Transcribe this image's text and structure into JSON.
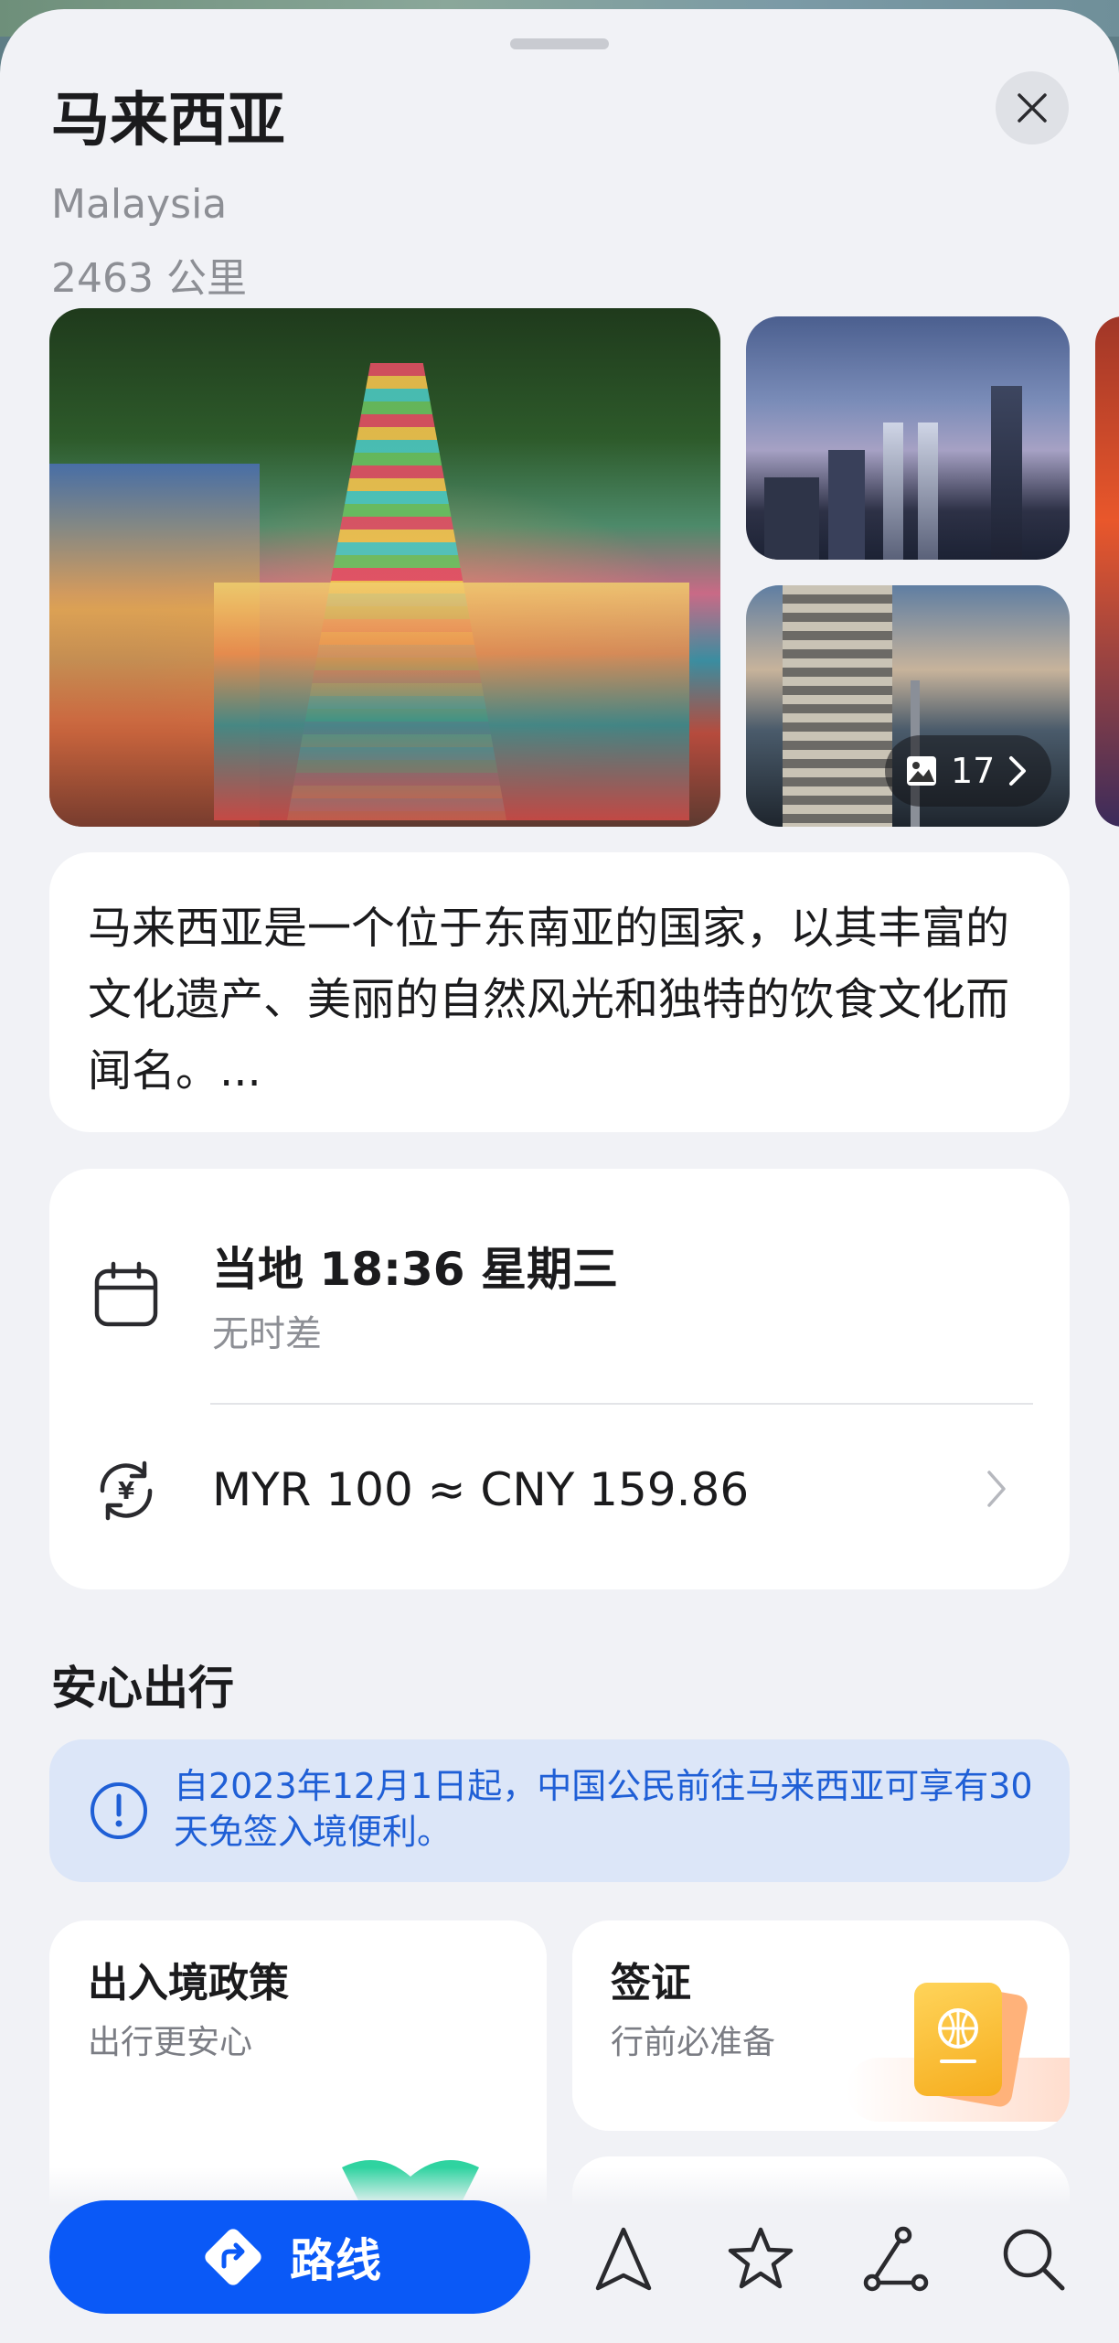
{
  "header": {
    "title": "马来西亚",
    "subtitle": "Malaysia",
    "distance": "2463 公里"
  },
  "gallery": {
    "photo_count": "17"
  },
  "description": {
    "text": "马来西亚是一个位于东南亚的国家，以其丰富的文化遗产、美丽的自然风光和独特的饮食文化而闻名。..."
  },
  "info": {
    "local_time": "当地 18:36 星期三",
    "time_diff": "无时差",
    "exchange": "MYR 100 ≈ CNY 159.86"
  },
  "travel": {
    "section_title": "安心出行",
    "notice": "自2023年12月1日起，中国公民前往马来西亚可享有30天免签入境便利。",
    "tiles": [
      {
        "title": "出入境政策",
        "subtitle": "出行更安心"
      },
      {
        "title": "签证",
        "subtitle": "行前必准备"
      }
    ]
  },
  "bottom_bar": {
    "route_label": "路线"
  },
  "colors": {
    "accent": "#0a59f7",
    "notice_bg": "#dce6f8",
    "notice_text": "#1f5fd6",
    "sheet_bg": "#f1f2f6"
  },
  "icons": [
    "close-icon",
    "image-icon",
    "chevron-right-icon",
    "calendar-icon",
    "currency-exchange-icon",
    "info-icon",
    "route-arrow-icon",
    "navigation-icon",
    "star-icon",
    "route-plan-icon",
    "search-icon"
  ]
}
